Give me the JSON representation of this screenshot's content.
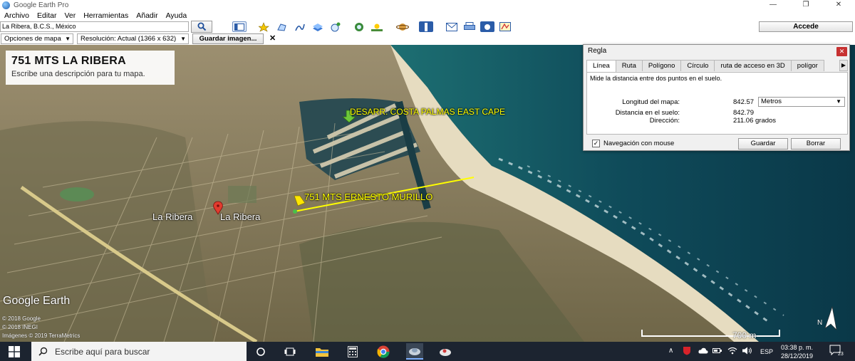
{
  "window": {
    "title": "Google Earth Pro",
    "minimize": "—",
    "restore": "❐",
    "close": "✕"
  },
  "menu": [
    {
      "label": "Archivo"
    },
    {
      "label": "Editar"
    },
    {
      "label": "Ver"
    },
    {
      "label": "Herramientas"
    },
    {
      "label": "Añadir"
    },
    {
      "label": "Ayuda"
    }
  ],
  "toolbar": {
    "search_value": "La Ribera, B.C.S., México",
    "access_label": "Accede"
  },
  "options": {
    "map_options": "Opciones de mapa",
    "resolution": "Resolución: Actual (1366 x 632)",
    "save_image": "Guardar imagen...",
    "close": "✕"
  },
  "map": {
    "title": "751 MTS LA RIBERA",
    "description": "Escribe una descripción para tu mapa.",
    "placemark_costa_palmas": "DESARR. COSTA PALMAS EAST CAPE",
    "placemark_ernesto": "751 MTS ERNESTO MURILLO",
    "town_label_1": "La Ribera",
    "town_label_2": "La Ribera",
    "brand": "Google Earth",
    "credit_1": "© 2018 Google",
    "credit_2": "© 2018 INEGI",
    "credit_3": "Imágenes © 2019 TerraMetrics",
    "scale_label": "700 m",
    "compass": "N"
  },
  "ruler": {
    "title": "Regla",
    "close": "✕",
    "tabs": [
      "Línea",
      "Ruta",
      "Polígono",
      "Círculo",
      "ruta de acceso en 3D",
      "polígor"
    ],
    "tab_scroll": "▶",
    "hint": "Mide la distancia entre dos puntos en el suelo.",
    "map_length_label": "Longitud del mapa:",
    "map_length_value": "842.57",
    "unit": "Metros",
    "ground_distance_label": "Distancia en el suelo:",
    "ground_distance_value": "842.79",
    "heading_label": "Dirección:",
    "heading_value": "211.06 grados",
    "mouse_nav_label": "Navegación con mouse",
    "save_label": "Guardar",
    "clear_label": "Borrar"
  },
  "taskbar": {
    "search_placeholder": "Escribe aquí para buscar",
    "language": "ESP",
    "time": "03:38 p. m.",
    "date": "28/12/2019",
    "notifications": "23"
  },
  "colors": {
    "placemark_label": "#ffff00",
    "ruler_line": "#ffff00",
    "taskbar": "#1c2430",
    "close_red": "#c73131"
  }
}
